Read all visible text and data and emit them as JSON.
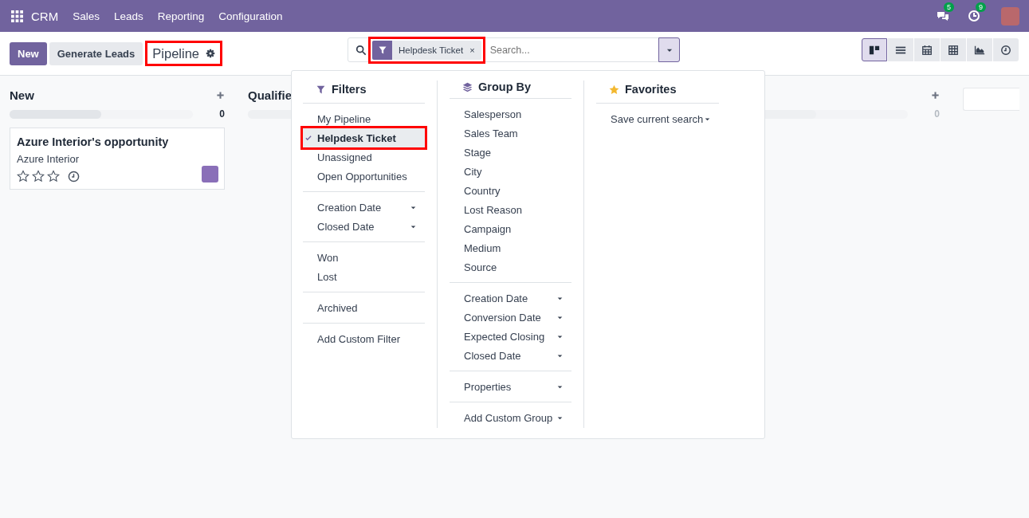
{
  "navbar": {
    "app": "CRM",
    "menus": [
      "Sales",
      "Leads",
      "Reporting",
      "Configuration"
    ],
    "messages_badge": "5",
    "activities_badge": "9"
  },
  "control_panel": {
    "buttons": [
      {
        "label": "New",
        "kind": "primary"
      },
      {
        "label": "Generate Leads",
        "kind": "secondary"
      }
    ],
    "breadcrumb": {
      "label": "Pipeline",
      "highlighted": true
    },
    "search": {
      "facet": {
        "label": "Helpdesk Ticket",
        "remove": "×",
        "highlighted": true
      },
      "placeholder": "Search...",
      "toggle_open": true
    },
    "views": [
      {
        "kind": "kanban",
        "selected": true
      },
      {
        "kind": "list",
        "selected": false
      },
      {
        "kind": "calendar",
        "selected": false
      },
      {
        "kind": "pivot",
        "selected": false
      },
      {
        "kind": "graph",
        "selected": false
      },
      {
        "kind": "activity",
        "selected": false
      }
    ]
  },
  "kanban": {
    "columns": [
      {
        "title": "New",
        "count": "0",
        "level": 0.5,
        "cards": [
          {
            "title": "Azure Interior's opportunity",
            "customer": "Azure Interior",
            "stars": 0
          }
        ]
      },
      {
        "title": "Qualifie",
        "level": 0.5
      },
      {
        "count": "0",
        "level": 0.5
      }
    ]
  },
  "search_panel": {
    "filters": {
      "title": "Filters",
      "groups": [
        [
          {
            "label": "My Pipeline",
            "kind": "item",
            "checked": false,
            "highlighted": false
          },
          {
            "label": "Helpdesk Ticket",
            "kind": "item",
            "checked": true,
            "highlighted": true
          },
          {
            "label": "Unassigned",
            "kind": "item",
            "checked": false,
            "highlighted": false
          },
          {
            "label": "Open Opportunities",
            "kind": "item",
            "checked": false,
            "highlighted": false
          }
        ],
        [
          {
            "label": "Creation Date",
            "kind": "submenu"
          },
          {
            "label": "Closed Date",
            "kind": "submenu"
          }
        ],
        [
          {
            "label": "Won",
            "kind": "item",
            "checked": false,
            "highlighted": false
          },
          {
            "label": "Lost",
            "kind": "item",
            "checked": false,
            "highlighted": false
          }
        ],
        [
          {
            "label": "Archived",
            "kind": "item",
            "checked": false,
            "highlighted": false
          }
        ],
        [
          {
            "label": "Add Custom Filter",
            "kind": "item",
            "checked": false,
            "highlighted": false
          }
        ]
      ]
    },
    "group_by": {
      "title": "Group By",
      "groups": [
        [
          {
            "label": "Salesperson",
            "kind": "item"
          },
          {
            "label": "Sales Team",
            "kind": "item"
          },
          {
            "label": "Stage",
            "kind": "item"
          },
          {
            "label": "City",
            "kind": "item"
          },
          {
            "label": "Country",
            "kind": "item"
          },
          {
            "label": "Lost Reason",
            "kind": "item"
          },
          {
            "label": "Campaign",
            "kind": "item"
          },
          {
            "label": "Medium",
            "kind": "item"
          },
          {
            "label": "Source",
            "kind": "item"
          }
        ],
        [
          {
            "label": "Creation Date",
            "kind": "submenu"
          },
          {
            "label": "Conversion Date",
            "kind": "submenu"
          },
          {
            "label": "Expected Closing",
            "kind": "submenu"
          },
          {
            "label": "Closed Date",
            "kind": "submenu"
          }
        ],
        [
          {
            "label": "Properties",
            "kind": "submenu"
          }
        ],
        [
          {
            "label": "Add Custom Group",
            "kind": "select"
          }
        ]
      ]
    },
    "favorites": {
      "title": "Favorites",
      "groups": [
        [
          {
            "label": "Save current search",
            "kind": "submenu"
          }
        ]
      ]
    }
  }
}
